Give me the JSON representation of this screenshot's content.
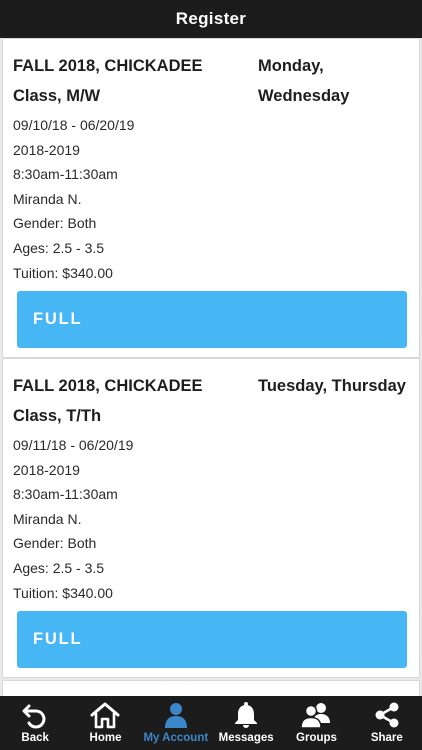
{
  "header": {
    "title": "Register"
  },
  "classes": [
    {
      "title": "FALL 2018, CHICKADEE Class, M/W",
      "days": "Monday, Wednesday",
      "dates": "09/10/18 - 06/20/19",
      "year": "2018-2019",
      "time": "8:30am-11:30am",
      "teacher": "Miranda N.",
      "gender": "Gender: Both",
      "ages": "Ages: 2.5 - 3.5",
      "tuition": "Tuition: $340.00",
      "button": "FULL"
    },
    {
      "title": "FALL 2018, CHICKADEE Class, T/Th",
      "days": "Tuesday, Thursday",
      "dates": "09/11/18 - 06/20/19",
      "year": "2018-2019",
      "time": "8:30am-11:30am",
      "teacher": "Miranda N.",
      "gender": "Gender: Both",
      "ages": "Ages: 2.5 - 3.5",
      "tuition": "Tuition: $340.00",
      "button": "FULL"
    }
  ],
  "tabbar": {
    "items": [
      {
        "label": "Back",
        "icon": "back-icon"
      },
      {
        "label": "Home",
        "icon": "home-icon"
      },
      {
        "label": "My Account",
        "icon": "user-icon",
        "active": true
      },
      {
        "label": "Messages",
        "icon": "bell-icon"
      },
      {
        "label": "Groups",
        "icon": "group-icon"
      },
      {
        "label": "Share",
        "icon": "share-icon"
      }
    ],
    "active_color": "#3a87c9"
  },
  "colors": {
    "button": "#46b6f4",
    "header": "#1c1c1c"
  }
}
